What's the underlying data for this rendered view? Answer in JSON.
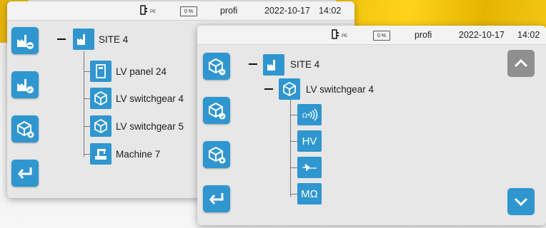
{
  "statusbar": {
    "connection_label": "PE",
    "battery_label": "0 %",
    "profile": "profi",
    "date": "2022-10-17",
    "time": "14:02"
  },
  "back_screen": {
    "statusbar": {
      "time": "14:02"
    },
    "tree": {
      "root": "SITE 4",
      "children": [
        "LV panel 24",
        "LV switchgear 4",
        "LV switchgear 5",
        "Machine 7"
      ]
    },
    "side_buttons": [
      "site-remove-icon",
      "site-edit-icon",
      "device-add-icon",
      "back-icon"
    ]
  },
  "front_screen": {
    "tree": {
      "root": "SITE 4",
      "device": "LV switchgear 4",
      "measurements": [
        "continuity-icon",
        "HV",
        "waveform-icon",
        "MΩ"
      ]
    },
    "side_buttons": [
      "device-remove-icon",
      "device-edit-icon",
      "device-add-icon",
      "back-icon"
    ],
    "arrows": [
      "up",
      "down"
    ]
  },
  "colors": {
    "accent": "#2f96cf",
    "panel": "#e7e7e7",
    "up_button": "#8f8f8f",
    "yellow_background": "#f1c20b"
  }
}
